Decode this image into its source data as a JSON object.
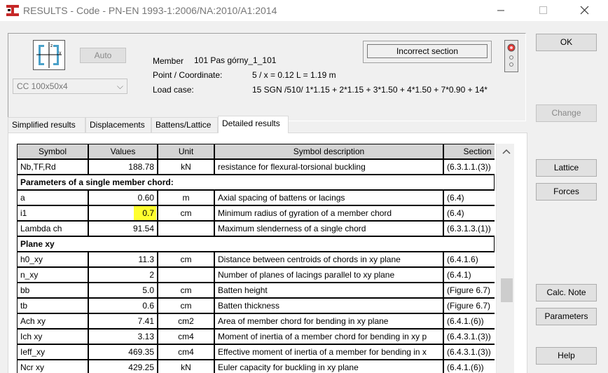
{
  "window": {
    "title": "RESULTS - Code - PN-EN 1993-1:2006/NA:2010/A1:2014",
    "minimize": "–",
    "maximize": "☐",
    "close": "✕"
  },
  "header": {
    "auto_label": "Auto",
    "section_combo": "CC 100x50x4",
    "member_label": "Member",
    "member_value": "101  Pas górny_1_101",
    "point_label": "Point / Coordinate:",
    "point_value": "5 / x = 0.12 L = 1.19 m",
    "load_label": "Load case:",
    "load_value": "15 SGN /510/  1*1.15 + 2*1.15 + 3*1.50 + 4*1.50 + 7*0.90 + 14*",
    "status_text": "Incorrect section"
  },
  "buttons": {
    "ok": "OK",
    "change": "Change",
    "lattice": "Lattice",
    "forces": "Forces",
    "calc_note": "Calc. Note",
    "parameters": "Parameters",
    "help": "Help"
  },
  "tabs": [
    "Simplified results",
    "Displacements",
    "Battens/Lattice",
    "Detailed results"
  ],
  "active_tab": "Detailed results",
  "table": {
    "headers": [
      "Symbol",
      "Values",
      "Unit",
      "Symbol description",
      "Section"
    ],
    "rows": [
      {
        "type": "data",
        "symbol": "Nb,TF,Rd",
        "value": "188.78",
        "unit": "kN",
        "desc": "resistance for flexural-torsional buckling",
        "section": "(6.3.1.1.(3))"
      },
      {
        "type": "group",
        "label": "Parameters of a single member chord:"
      },
      {
        "type": "data",
        "symbol": "a",
        "value": "0.60",
        "unit": "m",
        "desc": "Axial spacing of battens or lacings",
        "section": "(6.4)"
      },
      {
        "type": "data",
        "symbol": "i1",
        "value": "0.7",
        "unit": "cm",
        "desc": "Minimum radius of gyration of a member chord",
        "section": "(6.4)",
        "highlight": "#ffff2e"
      },
      {
        "type": "data",
        "symbol": "Lambda ch",
        "value": "91.54",
        "unit": "",
        "desc": "Maximum slenderness of a single chord",
        "section": "(6.3.1.3.(1))"
      },
      {
        "type": "group",
        "label": "Plane xy"
      },
      {
        "type": "data",
        "symbol": "h0_xy",
        "value": "11.3",
        "unit": "cm",
        "desc": "Distance between centroids of chords in xy plane",
        "section": "(6.4.1.6)"
      },
      {
        "type": "data",
        "symbol": "n_xy",
        "value": "2",
        "unit": "",
        "desc": "Number of planes of lacings parallel to xy plane",
        "section": "(6.4.1)"
      },
      {
        "type": "data",
        "symbol": "bb",
        "value": "5.0",
        "unit": "cm",
        "desc": "Batten height",
        "section": "(Figure 6.7)"
      },
      {
        "type": "data",
        "symbol": "tb",
        "value": "0.6",
        "unit": "cm",
        "desc": "Batten thickness",
        "section": "(Figure 6.7)"
      },
      {
        "type": "data",
        "symbol": "Ach xy",
        "value": "7.41",
        "unit": "cm2",
        "desc": "Area of member chord for bending in xy plane",
        "section": "(6.4.1.(6))"
      },
      {
        "type": "data",
        "symbol": "Ich xy",
        "value": "3.13",
        "unit": "cm4",
        "desc": "Moment of inertia of a member chord for bending in xy p",
        "section": "(6.4.3.1.(3))"
      },
      {
        "type": "data",
        "symbol": "Ieff_xy",
        "value": "469.35",
        "unit": "cm4",
        "desc": "Effective moment of inertia of a member for bending in x",
        "section": "(6.4.3.1.(3))"
      },
      {
        "type": "data",
        "symbol": "Ncr xy",
        "value": "429.25",
        "unit": "kN",
        "desc": "Euler capacity for buckling in xy plane",
        "section": "(6.4.1.(6))"
      }
    ]
  }
}
